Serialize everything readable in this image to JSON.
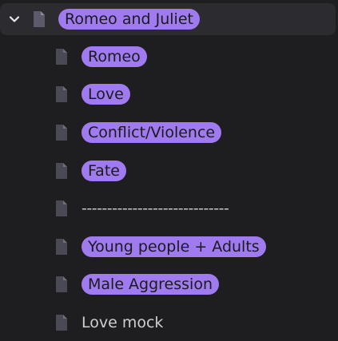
{
  "tree": {
    "parent": {
      "label": "Romeo and Juliet",
      "expand_icon": "chevron-down-icon",
      "icon": "document-icon"
    },
    "children": [
      {
        "label": "Romeo",
        "icon": "document-icon",
        "highlighted": true
      },
      {
        "label": "Love",
        "icon": "document-icon",
        "highlighted": true
      },
      {
        "label": "Conflict/Violence",
        "icon": "document-icon",
        "highlighted": true
      },
      {
        "label": "Fate",
        "icon": "document-icon",
        "highlighted": true
      },
      {
        "label": "-----------------------------",
        "icon": "document-icon",
        "highlighted": false
      },
      {
        "label": "Young people + Adults",
        "icon": "document-icon",
        "highlighted": true
      },
      {
        "label": "Male Aggression",
        "icon": "document-icon",
        "highlighted": true
      },
      {
        "label": "Love mock",
        "icon": "document-icon",
        "highlighted": false
      }
    ]
  },
  "colors": {
    "background": "#1e1e20",
    "parent_row_bg": "#2c2c30",
    "highlight": "#a07bf0",
    "icon_fill": "#4a4a55"
  }
}
